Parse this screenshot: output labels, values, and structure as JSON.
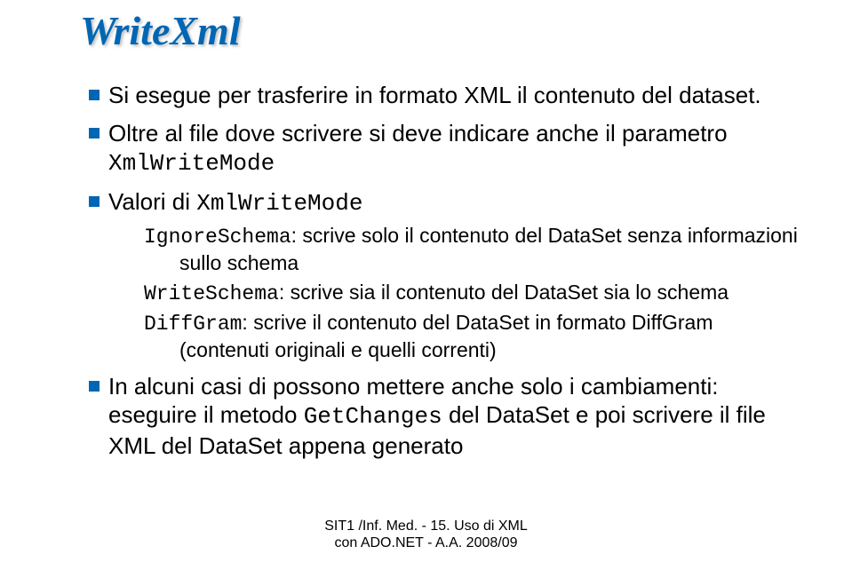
{
  "title": "WriteXml",
  "bullets": {
    "b1": "Si esegue per trasferire in formato XML il contenuto del dataset.",
    "b2_pre": "Oltre al file dove scrivere si deve indicare anche il parametro ",
    "b2_code": "XmlWriteMode",
    "b3_pre": "Valori di ",
    "b3_code": "XmlWriteMode",
    "sub1_code": "IgnoreSchema",
    "sub1_text": ": scrive solo il contenuto del DataSet senza informazioni sullo schema",
    "sub2_code": "WriteSchema",
    "sub2_text": ": scrive sia il contenuto del DataSet sia lo schema",
    "sub3_code": "DiffGram",
    "sub3_text": ": scrive il contenuto del DataSet in formato DiffGram (contenuti originali e quelli correnti)",
    "b4_pre": "In alcuni casi di possono mettere anche solo i cambiamenti: eseguire il metodo ",
    "b4_code": "GetChanges",
    "b4_post": " del DataSet e poi scrivere il file XML del DataSet appena generato"
  },
  "footer": {
    "line1": "SIT1 /Inf. Med. - 15. Uso di XML",
    "line2": "con ADO.NET - A.A. 2008/09"
  }
}
